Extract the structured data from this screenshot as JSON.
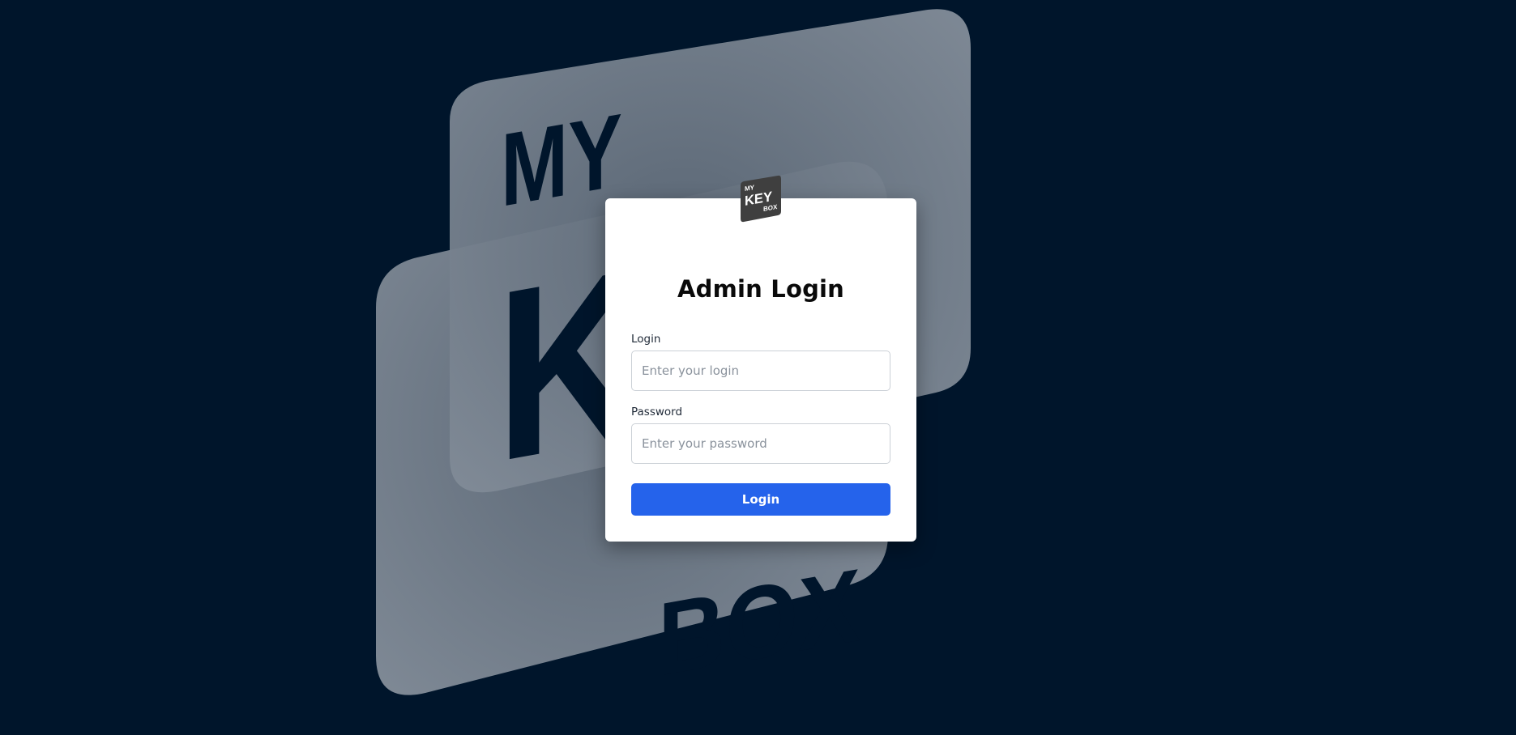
{
  "brand": {
    "logo_line1": "MY",
    "logo_line2": "KEY",
    "logo_line3": "BOX"
  },
  "page": {
    "title": "Admin Login"
  },
  "form": {
    "login_label": "Login",
    "login_placeholder": "Enter your login",
    "login_value": "",
    "password_label": "Password",
    "password_placeholder": "Enter your password",
    "password_value": "",
    "submit_label": "Login"
  },
  "colors": {
    "background": "#00152b",
    "card": "#ffffff",
    "accent": "#2563eb",
    "logo_tile": "#808a96"
  },
  "icons": {
    "background": "mykeybox-logo-watermark",
    "card": "mykeybox-logo-icon"
  }
}
